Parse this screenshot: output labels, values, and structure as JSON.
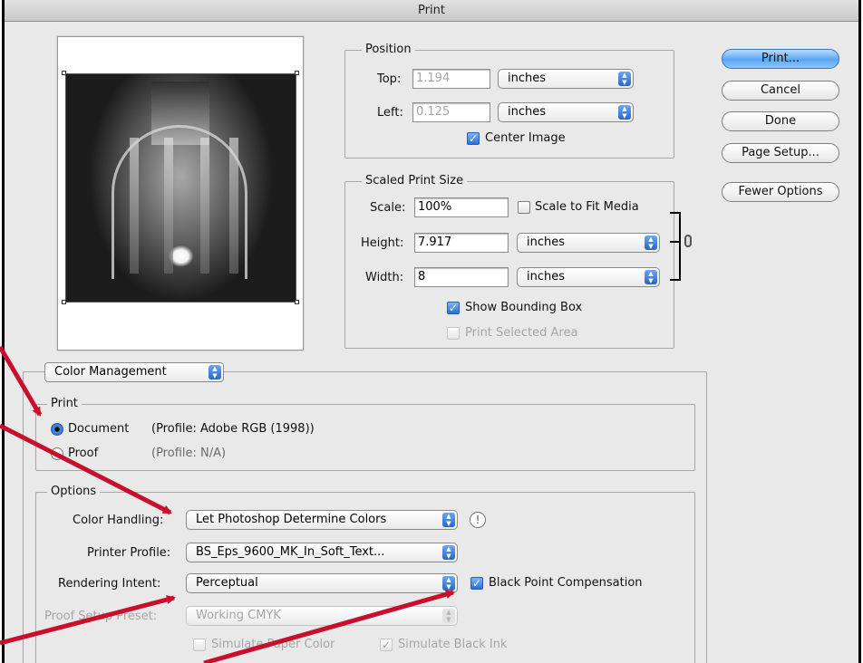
{
  "window": {
    "title": "Print"
  },
  "buttons": {
    "print": "Print...",
    "cancel": "Cancel",
    "done": "Done",
    "page_setup": "Page Setup...",
    "fewer_options": "Fewer Options"
  },
  "position": {
    "legend": "Position",
    "top_label": "Top:",
    "top_value": "1.194",
    "top_unit": "inches",
    "left_label": "Left:",
    "left_value": "0.125",
    "left_unit": "inches",
    "center_image": "Center Image",
    "center_image_checked": true
  },
  "scaled": {
    "legend": "Scaled Print Size",
    "scale_label": "Scale:",
    "scale_value": "100%",
    "scale_to_fit": "Scale to Fit Media",
    "height_label": "Height:",
    "height_value": "7.917",
    "height_unit": "inches",
    "width_label": "Width:",
    "width_value": "8",
    "width_unit": "inches",
    "show_bbox": "Show Bounding Box",
    "show_bbox_checked": true,
    "print_selected": "Print Selected Area"
  },
  "section_popup": "Color Management",
  "print_group": {
    "legend": "Print",
    "document_label": "Document",
    "document_profile": "(Profile: Adobe RGB (1998))",
    "proof_label": "Proof",
    "proof_profile": "(Profile: N/A)",
    "selected": "Document"
  },
  "options": {
    "legend": "Options",
    "color_handling_label": "Color Handling:",
    "color_handling_value": "Let Photoshop Determine Colors",
    "printer_profile_label": "Printer Profile:",
    "printer_profile_value": "BS_Eps_9600_MK_In_Soft_Text...",
    "rendering_intent_label": "Rendering Intent:",
    "rendering_intent_value": "Perceptual",
    "black_point": "Black Point Compensation",
    "black_point_checked": true,
    "proof_setup_label": "Proof Setup Preset:",
    "proof_setup_value": "Working CMYK",
    "simulate_paper": "Simulate Paper Color",
    "simulate_black": "Simulate Black Ink"
  },
  "colors": {
    "annotation_arrow": "#c8102e",
    "default_button": "#5aa6f4"
  },
  "icons": {
    "warning": "!",
    "popup_arrows": "▲▼",
    "check": "✓"
  }
}
